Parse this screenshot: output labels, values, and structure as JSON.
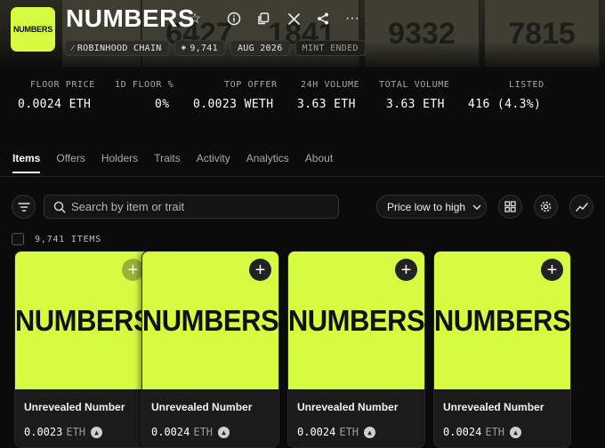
{
  "collection": {
    "title": "NUMBERS",
    "logo_text": "NUMBERS",
    "accent_color": "#d6fb41",
    "tags": [
      {
        "icon": "link-icon",
        "label": "ROBINHOOD CHAIN"
      },
      {
        "icon": "stack-icon",
        "label": "9,741"
      },
      {
        "icon": "",
        "label": "AUG 2026"
      },
      {
        "icon": "",
        "label": "MINT ENDED"
      }
    ],
    "banner_numbers": [
      "",
      "6427",
      "1841",
      "9332",
      "7815"
    ]
  },
  "stats": [
    {
      "label": "FLOOR PRICE",
      "value": "0.0024 ETH"
    },
    {
      "label": "1D FLOOR %",
      "value": "0%"
    },
    {
      "label": "TOP OFFER",
      "value": "0.0023 WETH"
    },
    {
      "label": "24H VOLUME",
      "value": "3.63 ETH"
    },
    {
      "label": "TOTAL VOLUME",
      "value": "3.63 ETH"
    },
    {
      "label": "LISTED",
      "value": "416 (4.3%)"
    }
  ],
  "tabs": [
    "Items",
    "Offers",
    "Holders",
    "Traits",
    "Activity",
    "Analytics",
    "About"
  ],
  "active_tab": "Items",
  "search": {
    "placeholder": "Search by item or trait"
  },
  "sort": {
    "selected": "Price low to high"
  },
  "items_count": "9,741 ITEMS",
  "items": [
    {
      "art_text": "NUMBERS",
      "name": "Unrevealed Number",
      "price": "0.0023",
      "currency": "ETH"
    },
    {
      "art_text": "NUMBERS",
      "name": "Unrevealed Number",
      "price": "0.0024",
      "currency": "ETH"
    },
    {
      "art_text": "NUMBERS",
      "name": "Unrevealed Number",
      "price": "0.0024",
      "currency": "ETH"
    },
    {
      "art_text": "NUMBERS",
      "name": "Unrevealed Number",
      "price": "0.0024",
      "currency": "ETH"
    }
  ]
}
